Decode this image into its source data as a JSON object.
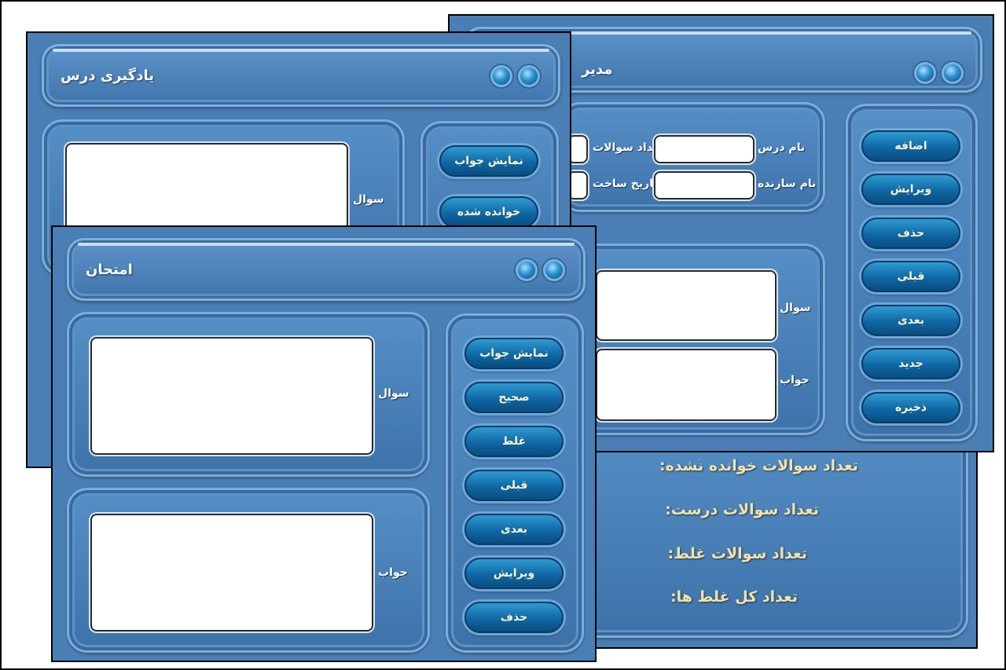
{
  "learn_window": {
    "title": "یادگیری درس",
    "show_answer": "نمایش جواب",
    "read_done": "خوانده شده",
    "question_label": "سوال"
  },
  "manage_window": {
    "title": "مدیر",
    "lesson_name": "نام درس",
    "question_count": "تعداد سوالات",
    "creator_name": "نام سازنده",
    "creation_date": "تاریخ ساخت",
    "question_label": "سوال",
    "answer_label": "جواب",
    "buttons": [
      "اضافه",
      "ویرایش",
      "حذف",
      "قبلی",
      "بعدی",
      "جدید",
      "ذخیره"
    ]
  },
  "stats_window": {
    "unread": "تعداد سوالات خوانده نشده:",
    "correct": "تعداد سوالات درست:",
    "wrong": "تعداد سوالات غلط:",
    "total_wrong": "تعداد کل غلط ها:"
  },
  "exam_window": {
    "title": "امتحان",
    "question_label": "سوال",
    "answer_label": "جواب",
    "buttons": [
      "نمایش جواب",
      "صحیح",
      "غلط",
      "قبلی",
      "بعدی",
      "ویرایش",
      "حذف"
    ]
  },
  "colors": {
    "window_bg": "#4a7fb5",
    "button": "#1a78b8",
    "stat_text": "#f5e2a6"
  },
  "icons": [
    "orb-icon"
  ]
}
